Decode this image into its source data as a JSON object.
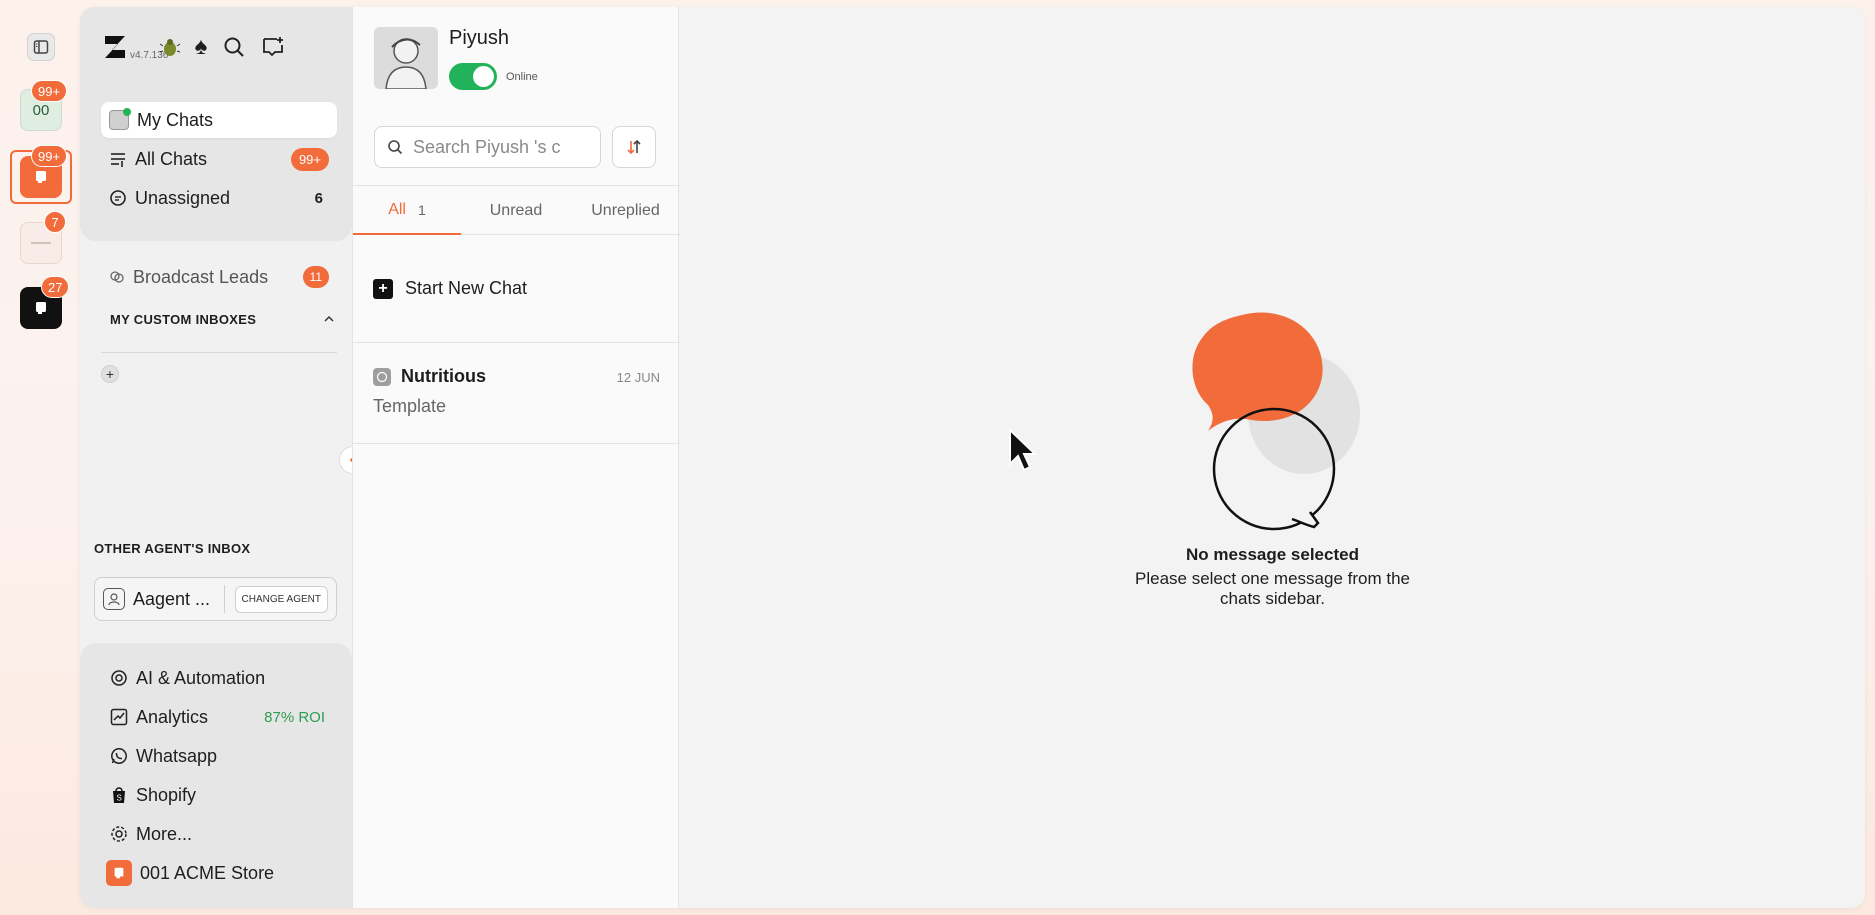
{
  "app": {
    "version": "v4.7.136"
  },
  "rail": {
    "workspaces": [
      {
        "label": "00",
        "badge": "99+"
      },
      {
        "badge": "99+"
      },
      {
        "badge": "7"
      },
      {
        "badge": "27"
      }
    ]
  },
  "nav": {
    "items": [
      {
        "label": "My Chats"
      },
      {
        "label": "All Chats",
        "badge": "99+"
      },
      {
        "label": "Unassigned",
        "count": "6"
      }
    ],
    "broadcast": {
      "label": "Broadcast Leads",
      "badge": "11"
    },
    "custom_inboxes_title": "MY CUSTOM INBOXES",
    "other_agents_title": "OTHER AGENT'S INBOX",
    "agent": {
      "name": "Aagent ...",
      "change_label": "CHANGE AGENT"
    },
    "bottom": [
      {
        "label": "AI & Automation"
      },
      {
        "label": "Analytics",
        "tag": "87% ROI"
      },
      {
        "label": "Whatsapp"
      },
      {
        "label": "Shopify"
      },
      {
        "label": "More..."
      },
      {
        "label": "001 ACME Store"
      }
    ]
  },
  "profile": {
    "name": "Piyush",
    "status": "Online",
    "online": true
  },
  "search": {
    "placeholder": "Search Piyush 's c"
  },
  "tabs": [
    {
      "label": "All",
      "count": "1"
    },
    {
      "label": "Unread"
    },
    {
      "label": "Unreplied"
    }
  ],
  "start_chat_label": "Start New Chat",
  "chats": [
    {
      "name": "Nutritious",
      "date": "12 JUN",
      "preview": "Template"
    }
  ],
  "empty": {
    "title": "No message selected",
    "description": "Please select one message from the chats sidebar."
  },
  "colors": {
    "accent": "#f26b3a",
    "toggle": "#22b35a",
    "roi": "#2e9e4f"
  }
}
